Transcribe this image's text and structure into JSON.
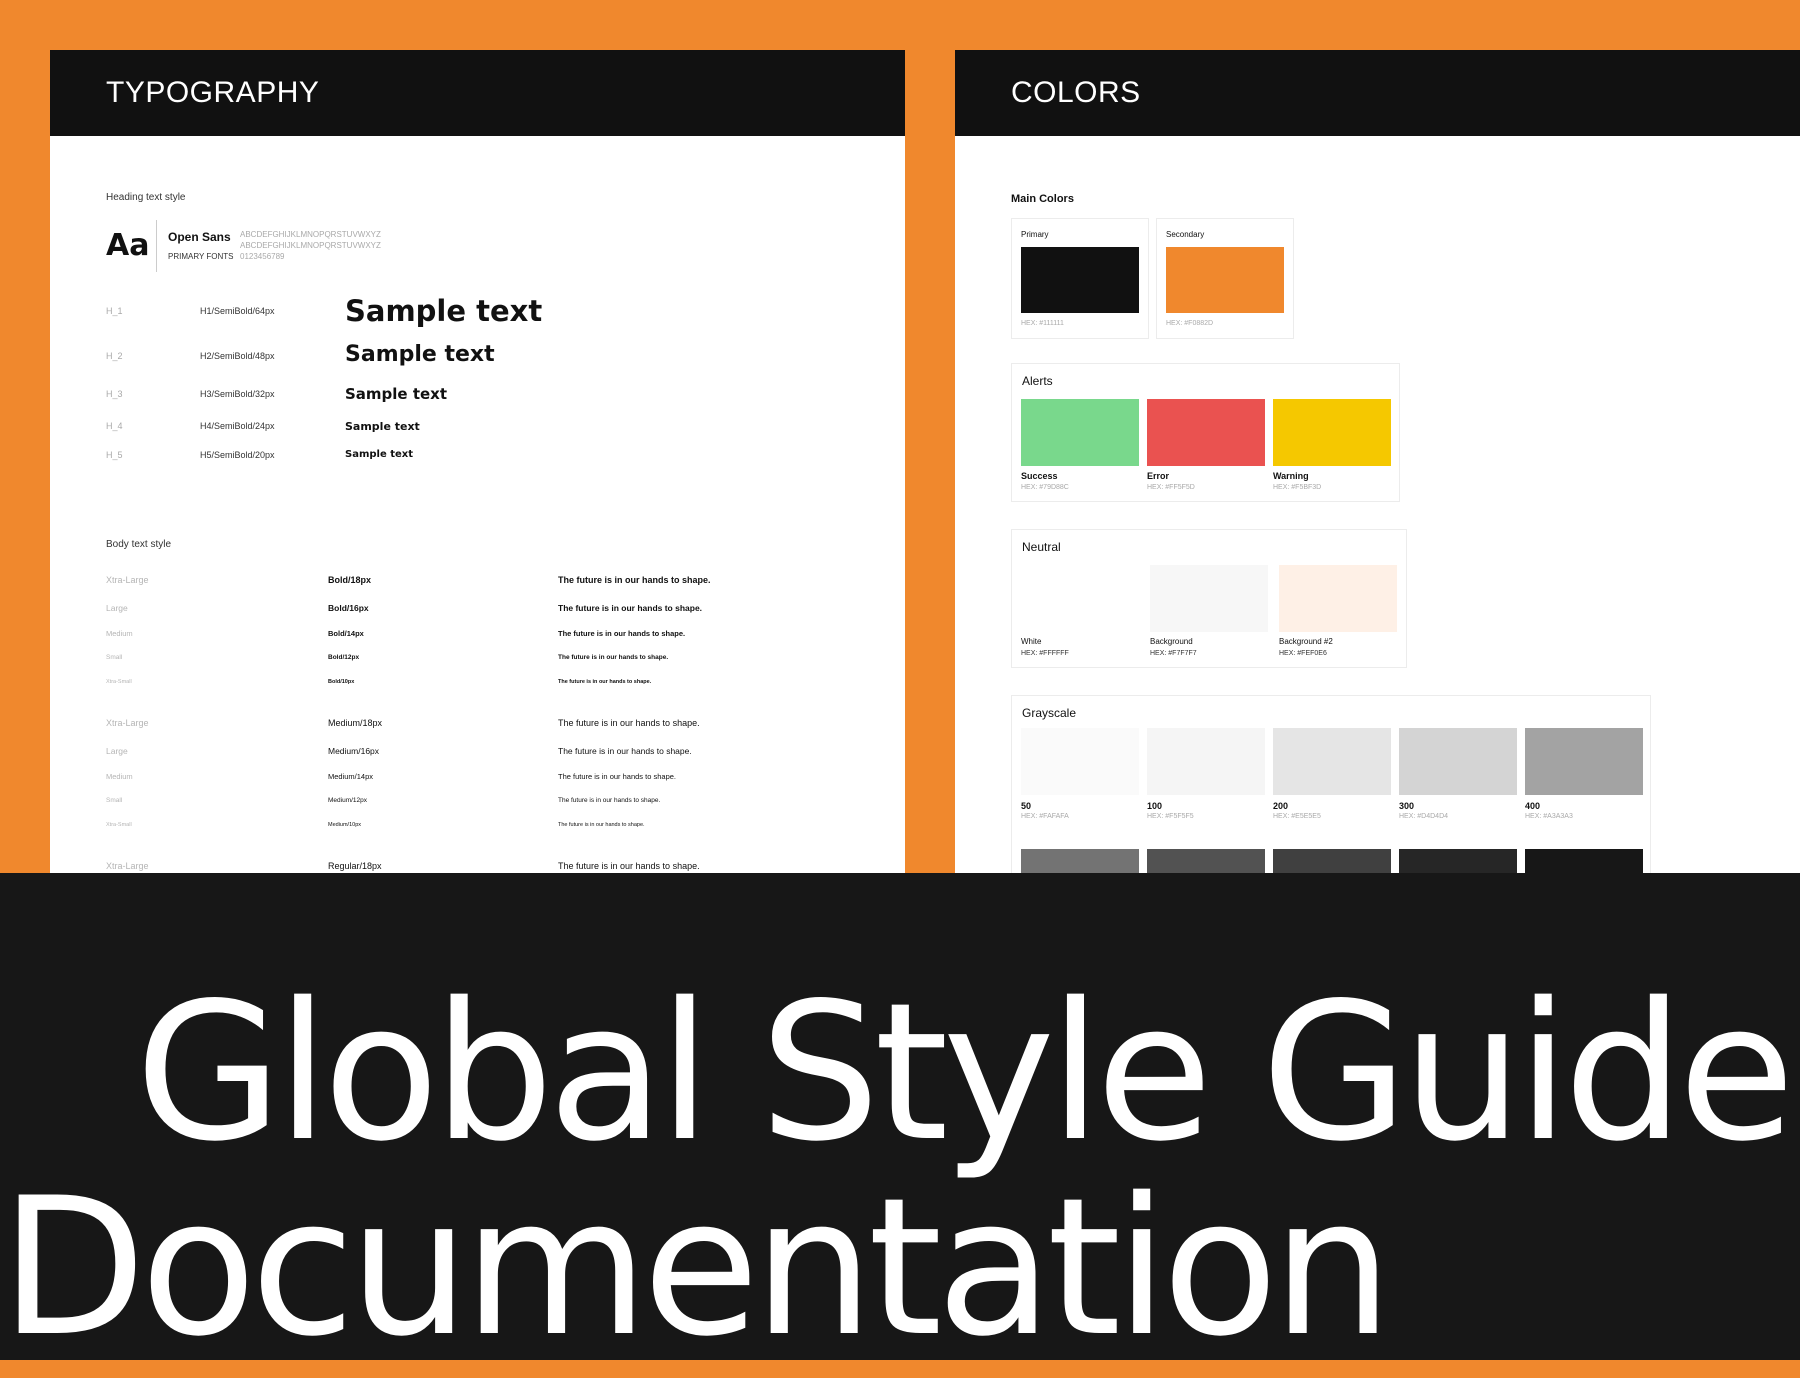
{
  "typography": {
    "header": "TYPOGRAPHY",
    "heading_label": "Heading text style",
    "font_sample": "Aa",
    "font_name": "Open Sans",
    "font_role": "PRIMARY FONTS",
    "alphabet_upper": "ABCDEFGHIJKLMNOPQRSTUVWXYZ",
    "alphabet_lower": "ABCDEFGHIJKLMNOPQRSTUVWXYZ",
    "digits": "0123456789",
    "headings": [
      {
        "name": "H_1",
        "spec": "H1/SemiBold/64px",
        "sample": "Sample text"
      },
      {
        "name": "H_2",
        "spec": "H2/SemiBold/48px",
        "sample": "Sample text"
      },
      {
        "name": "H_3",
        "spec": "H3/SemiBold/32px",
        "sample": "Sample text"
      },
      {
        "name": "H_4",
        "spec": "H4/SemiBold/24px",
        "sample": "Sample text"
      },
      {
        "name": "H_5",
        "spec": "H5/SemiBold/20px",
        "sample": "Sample text"
      }
    ],
    "body_label": "Body text style",
    "body_groups": [
      {
        "weight": "bold",
        "rows": [
          {
            "size": "Xtra-Large",
            "spec": "Bold/18px",
            "text": "The future is in our hands to shape."
          },
          {
            "size": "Large",
            "spec": "Bold/16px",
            "text": "The future is in our hands to shape."
          },
          {
            "size": "Medium",
            "spec": "Bold/14px",
            "text": "The future is in our hands to shape."
          },
          {
            "size": "Small",
            "spec": "Bold/12px",
            "text": "The future is in our hands to shape."
          },
          {
            "size": "Xtra-Small",
            "spec": "Bold/10px",
            "text": "The future is in our hands to shape."
          }
        ]
      },
      {
        "weight": "medium",
        "rows": [
          {
            "size": "Xtra-Large",
            "spec": "Medium/18px",
            "text": "The future is in our hands to shape."
          },
          {
            "size": "Large",
            "spec": "Medium/16px",
            "text": "The future is in our hands to shape."
          },
          {
            "size": "Medium",
            "spec": "Medium/14px",
            "text": "The future is in our hands to shape."
          },
          {
            "size": "Small",
            "spec": "Medium/12px",
            "text": "The future is in our hands to shape."
          },
          {
            "size": "Xtra-Small",
            "spec": "Medium/10px",
            "text": "The future is in our hands to shape."
          }
        ]
      },
      {
        "weight": "regular",
        "rows": [
          {
            "size": "Xtra-Large",
            "spec": "Regular/18px",
            "text": "The future is in our hands to shape."
          }
        ]
      }
    ]
  },
  "colors": {
    "header": "COLORS",
    "main_title": "Main Colors",
    "main": [
      {
        "name": "Primary",
        "hex": "HEX: #111111",
        "color": "#111111"
      },
      {
        "name": "Secondary",
        "hex": "HEX: #F0882D",
        "color": "#F0882D"
      }
    ],
    "alerts_title": "Alerts",
    "alerts": [
      {
        "name": "Success",
        "hex": "HEX: #79D88C",
        "color": "#79D88C"
      },
      {
        "name": "Error",
        "hex": "HEX: #FF5F5D",
        "color": "#EA5250"
      },
      {
        "name": "Warning",
        "hex": "HEX: #F5BF3D",
        "color": "#F5C800"
      }
    ],
    "neutral_title": "Neutral",
    "neutral": [
      {
        "name": "White",
        "hex": "HEX: #FFFFFF",
        "color": "#FFFFFF"
      },
      {
        "name": "Background",
        "hex": "HEX: #F7F7F7",
        "color": "#F7F7F7"
      },
      {
        "name": "Background #2",
        "hex": "HEX: #FEF0E6",
        "color": "#FEF0E6"
      }
    ],
    "grayscale_title": "Grayscale",
    "grayscale": [
      {
        "name": "50",
        "hex": "HEX: #FAFAFA",
        "color": "#FAFAFA"
      },
      {
        "name": "100",
        "hex": "HEX: #F5F5F5",
        "color": "#F5F5F5"
      },
      {
        "name": "200",
        "hex": "HEX: #E5E5E5",
        "color": "#E5E5E5"
      },
      {
        "name": "300",
        "hex": "HEX: #D4D4D4",
        "color": "#D4D4D4"
      },
      {
        "name": "400",
        "hex": "HEX: #A3A3A3",
        "color": "#A3A3A3"
      }
    ],
    "grayscale_dark": [
      "#737373",
      "#525252",
      "#404040",
      "#262626",
      "#171717"
    ]
  },
  "title": {
    "line1": "Global Style Guide",
    "line2": "Documentation"
  }
}
